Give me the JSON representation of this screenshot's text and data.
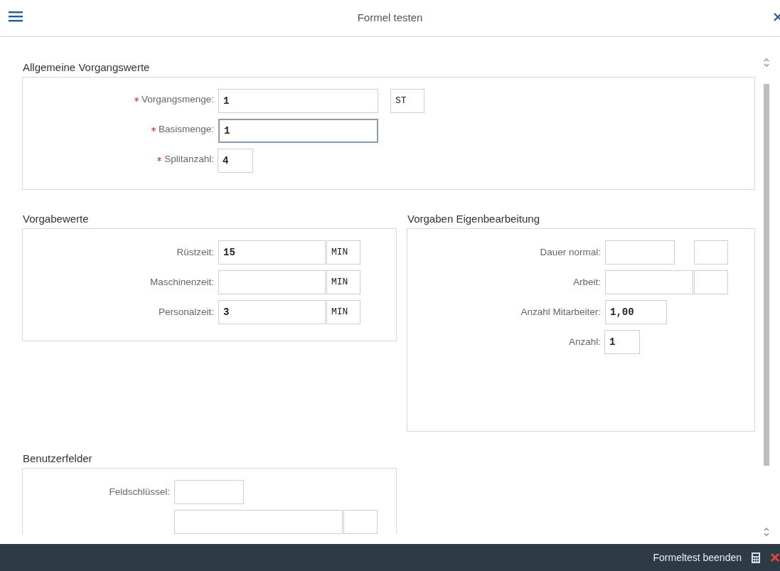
{
  "window": {
    "title": "Formel testen"
  },
  "sections": [
    {
      "title": "Allgemeine Vorgangswerte",
      "rows": [
        {
          "label": "Vorgangsmenge:",
          "required": true,
          "fields": [
            {
              "kind": "quantity",
              "value": "1",
              "focused": false
            },
            {
              "kind": "unit",
              "value": "ST",
              "focused": false
            }
          ]
        },
        {
          "label": "Basismenge:",
          "required": true,
          "fields": [
            {
              "kind": "quantity",
              "value": "1",
              "focused": true
            }
          ]
        },
        {
          "label": "Splitanzahl:",
          "required": true,
          "fields": [
            {
              "kind": "short",
              "value": "4",
              "focused": false
            }
          ]
        }
      ]
    },
    {
      "title": "Vorgabewerte",
      "rows": [
        {
          "label": "Rüstzeit:",
          "required": false,
          "fields": [
            {
              "kind": "time",
              "value": "15",
              "focused": false
            },
            {
              "kind": "unit",
              "value": "MIN",
              "focused": false
            }
          ]
        },
        {
          "label": "Maschinenzeit:",
          "required": false,
          "fields": [
            {
              "kind": "time",
              "focused": false
            },
            {
              "kind": "unit",
              "value": "MIN",
              "focused": false
            }
          ]
        },
        {
          "label": "Personalzeit:",
          "required": false,
          "fields": [
            {
              "kind": "time",
              "value": "3",
              "focused": false
            },
            {
              "kind": "unit",
              "value": "MIN",
              "focused": false
            }
          ]
        }
      ]
    },
    {
      "title": "Vorgaben Eigenbearbeitung",
      "rows": [
        {
          "label": "Dauer normal:",
          "required": false,
          "fields": [
            {
              "kind": "duration",
              "focused": false
            },
            {
              "kind": "unit",
              "focused": false
            }
          ]
        },
        {
          "label": "Arbeit:",
          "required": false,
          "fields": [
            {
              "kind": "work",
              "focused": false
            },
            {
              "kind": "unit",
              "focused": false
            }
          ]
        },
        {
          "label": "Anzahl Mitarbeiter:",
          "required": false,
          "fields": [
            {
              "kind": "count",
              "value": "1,00",
              "focused": false
            }
          ]
        },
        {
          "label": "Anzahl:",
          "required": false,
          "fields": [
            {
              "kind": "short",
              "value": "1",
              "focused": false
            }
          ]
        }
      ]
    },
    {
      "title": "Benutzerfelder",
      "rows": [
        {
          "label": "Feldschlüssel:",
          "required": false,
          "fields": [
            {
              "kind": "duration",
              "focused": false
            }
          ]
        },
        {
          "required": false,
          "fields": [
            {
              "kind": "text",
              "focused": false
            },
            {
              "kind": "unit",
              "focused": false
            }
          ]
        }
      ]
    }
  ],
  "footer": {
    "button": "Formeltest beenden"
  }
}
